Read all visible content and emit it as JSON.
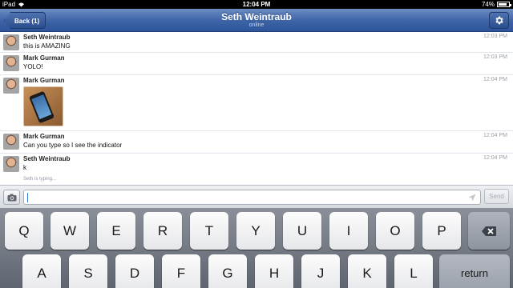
{
  "status": {
    "device": "iPad",
    "time": "12:04 PM",
    "battery": "74%",
    "battery_level": 0.74
  },
  "nav": {
    "back_label": "Back (1)",
    "title": "Seth Weintraub",
    "subtitle": "online",
    "settings_icon": "gear-icon"
  },
  "messages": [
    {
      "sender": "Seth Weintraub",
      "text": "this is AMAZING",
      "time": "12:03 PM"
    },
    {
      "sender": "Mark Gurman",
      "text": "YOLO!",
      "time": "12:03 PM"
    },
    {
      "sender": "Mark Gurman",
      "text": "",
      "time": "12:04 PM",
      "attachment": "photo of smartphone"
    },
    {
      "sender": "Mark Gurman",
      "text": "Can you type so I see the indicator",
      "time": "12:04 PM"
    },
    {
      "sender": "Seth Weintraub",
      "text": "k",
      "time": "12:04 PM"
    }
  ],
  "typing_indicator": "Seth is typing...",
  "composer": {
    "value": "",
    "camera_icon": "camera-icon",
    "send_label": "Send"
  },
  "keyboard": {
    "row1": [
      "Q",
      "W",
      "E",
      "R",
      "T",
      "Y",
      "U",
      "I",
      "O",
      "P"
    ],
    "row2": [
      "A",
      "S",
      "D",
      "F",
      "G",
      "H",
      "J",
      "K",
      "L"
    ],
    "backspace_icon": "backspace-icon",
    "return_label": "return"
  },
  "colors": {
    "nav": "#3d63a6",
    "time": "#9aa0a8",
    "caret": "#3a7bd5"
  }
}
